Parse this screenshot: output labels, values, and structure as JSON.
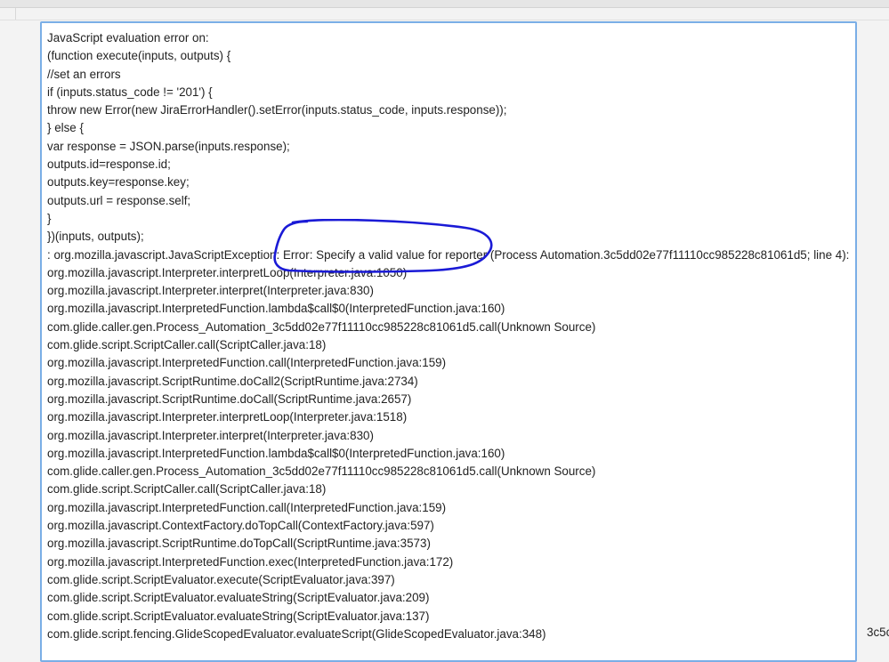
{
  "log": {
    "lines": [
      "JavaScript evaluation error on:",
      "(function execute(inputs, outputs) {",
      "//set an errors",
      "if (inputs.status_code != '201') {",
      "throw new Error(new JiraErrorHandler().setError(inputs.status_code, inputs.response));",
      "} else {",
      "var response = JSON.parse(inputs.response);",
      "outputs.id=response.id;",
      "outputs.key=response.key;",
      "outputs.url = response.self;",
      "}",
      "})(inputs, outputs);",
      ": org.mozilla.javascript.JavaScriptException: Error: Specify a valid value for reporter (Process Automation.3c5dd02e77f11110cc985228c81061d5; line 4):",
      "org.mozilla.javascript.Interpreter.interpretLoop(Interpreter.java:1050)",
      "org.mozilla.javascript.Interpreter.interpret(Interpreter.java:830)",
      "org.mozilla.javascript.InterpretedFunction.lambda$call$0(InterpretedFunction.java:160)",
      "com.glide.caller.gen.Process_Automation_3c5dd02e77f11110cc985228c81061d5.call(Unknown Source)",
      "com.glide.script.ScriptCaller.call(ScriptCaller.java:18)",
      "org.mozilla.javascript.InterpretedFunction.call(InterpretedFunction.java:159)",
      "org.mozilla.javascript.ScriptRuntime.doCall2(ScriptRuntime.java:2734)",
      "org.mozilla.javascript.ScriptRuntime.doCall(ScriptRuntime.java:2657)",
      "org.mozilla.javascript.Interpreter.interpretLoop(Interpreter.java:1518)",
      "org.mozilla.javascript.Interpreter.interpret(Interpreter.java:830)",
      "org.mozilla.javascript.InterpretedFunction.lambda$call$0(InterpretedFunction.java:160)",
      "com.glide.caller.gen.Process_Automation_3c5dd02e77f11110cc985228c81061d5.call(Unknown Source)",
      "com.glide.script.ScriptCaller.call(ScriptCaller.java:18)",
      "org.mozilla.javascript.InterpretedFunction.call(InterpretedFunction.java:159)",
      "org.mozilla.javascript.ContextFactory.doTopCall(ContextFactory.java:597)",
      "org.mozilla.javascript.ScriptRuntime.doTopCall(ScriptRuntime.java:3573)",
      "org.mozilla.javascript.InterpretedFunction.exec(InterpretedFunction.java:172)",
      "com.glide.script.ScriptEvaluator.execute(ScriptEvaluator.java:397)",
      "com.glide.script.ScriptEvaluator.evaluateString(ScriptEvaluator.java:209)",
      "com.glide.script.ScriptEvaluator.evaluateString(ScriptEvaluator.java:137)",
      "com.glide.script.fencing.GlideScopedEvaluator.evaluateScript(GlideScopedEvaluator.java:348)"
    ]
  },
  "side_text": "3c5c",
  "annotation": {
    "color": "#1a1ad6",
    "icon": "hand-drawn-circle-annotation"
  }
}
